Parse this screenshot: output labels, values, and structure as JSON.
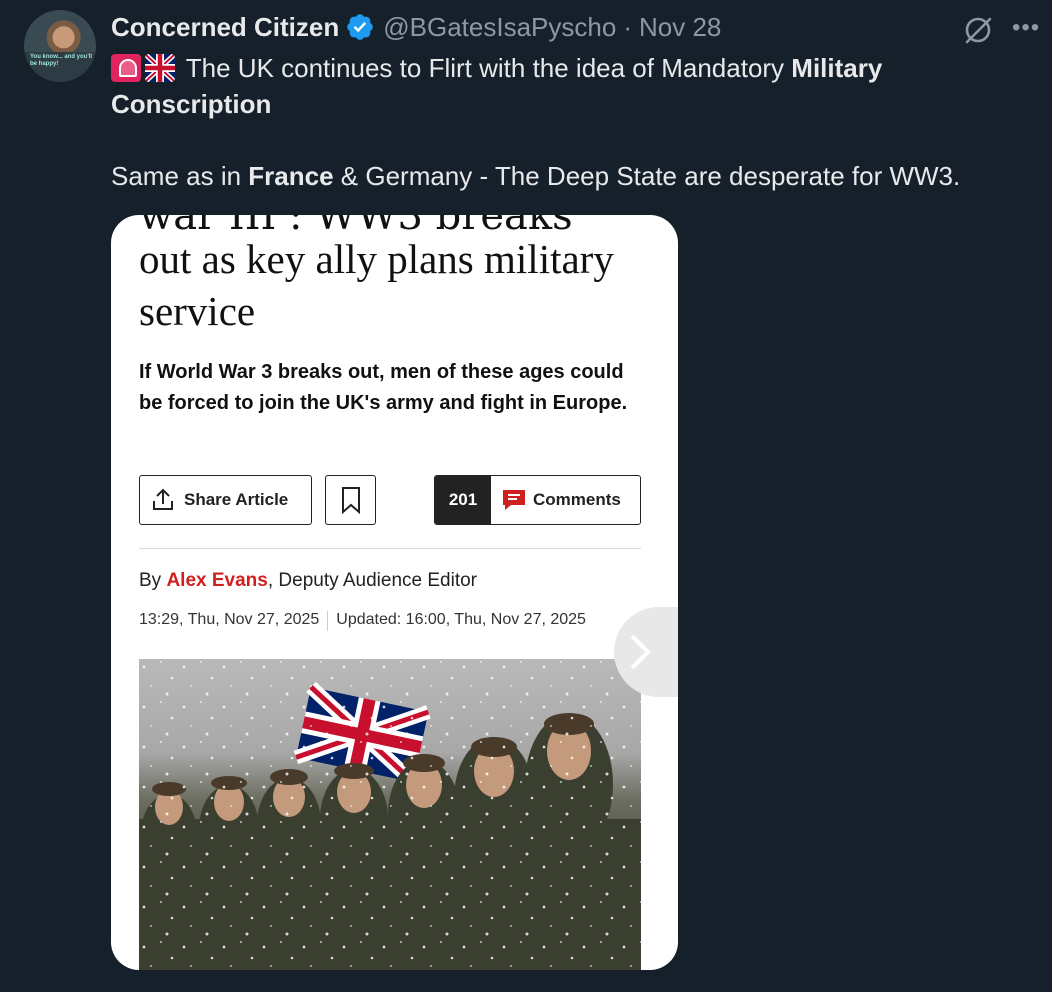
{
  "author": {
    "display_name": "Concerned Citizen",
    "handle": "@BGatesIsaPyscho",
    "date": "Nov 28",
    "avatar_caption": "You know... and you'll be happy!"
  },
  "tweet": {
    "line1_before": "The UK continues to Flirt with the idea of Mandatory ",
    "line1_bold": "Military Conscription",
    "line2_before": "Same as in ",
    "line2_bold": "France",
    "line2_after": " & Germany - The Deep State are desperate for WW3."
  },
  "article": {
    "cut_headline": "war III : WW3 breaks",
    "headline": "out as key ally plans military service",
    "standfirst": "If World War 3 breaks out, men of these ages could be forced to join the UK's army and fight in Europe.",
    "share_label": "Share Article",
    "comment_count": "201",
    "comments_label": "Comments",
    "byline_prefix": "By ",
    "author_name": "Alex Evans",
    "author_role": ", Deputy Audience Editor",
    "published": "13:29, Thu, Nov 27, 2025",
    "updated": "Updated: 16:00, Thu, Nov 27, 2025"
  },
  "icons": {
    "verified": "verified-badge-icon",
    "grok": "grok-icon",
    "more": "more-icon",
    "share": "share-icon",
    "bookmark": "bookmark-icon",
    "comment": "comment-icon",
    "next": "chevron-right-icon"
  },
  "colors": {
    "background": "#15202b",
    "verified": "#1d9bf0",
    "author_link": "#d01f1f"
  }
}
